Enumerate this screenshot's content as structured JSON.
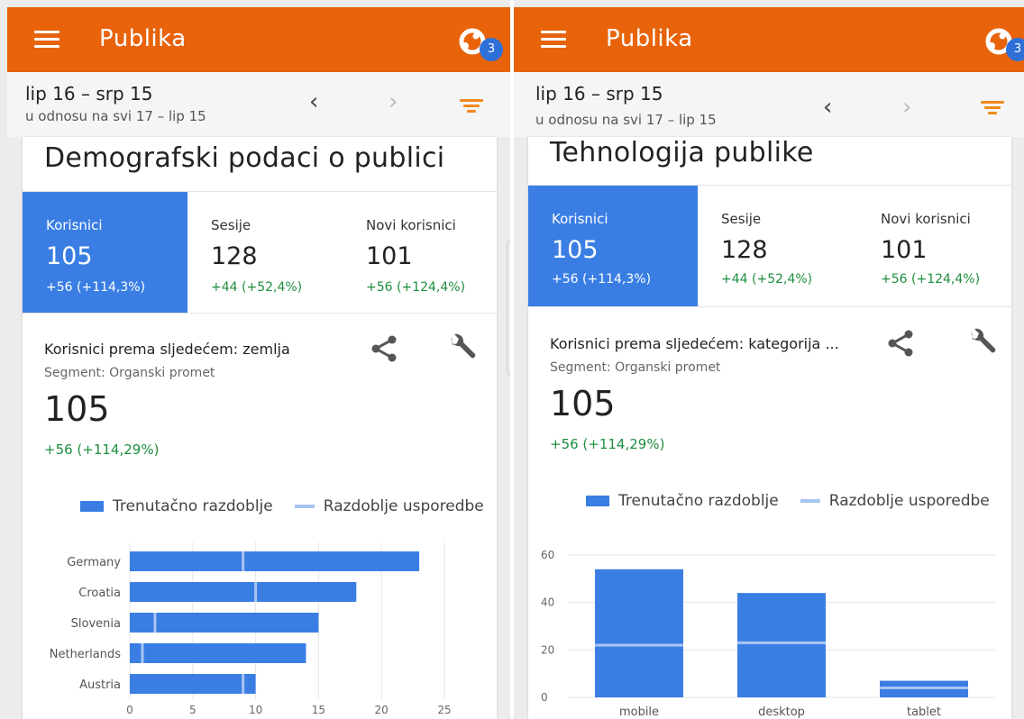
{
  "colors": {
    "appbar": "#e8630a",
    "accent": "#3a7ee4",
    "positive": "#1e8e3e",
    "filter": "#f08a1e",
    "badge": "#2f6fd8",
    "compare": "#a8c4f2"
  },
  "panels": [
    {
      "app_title": "Publika",
      "notification_count": "3",
      "date_range": "lip 16 – srp 15",
      "comparison": "u odnosu na svi 17 – lip 15",
      "prev_label": "‹",
      "next_label": "›",
      "card_title": "Demografski podaci o publici",
      "metrics": [
        {
          "label": "Korisnici",
          "value": "105",
          "change": "+56 (+114,3%)",
          "active": true
        },
        {
          "label": "Sesije",
          "value": "128",
          "change": "+44 (+52,4%)",
          "active": false
        },
        {
          "label": "Novi korisnici",
          "value": "101",
          "change": "+56 (+124,4%)",
          "active": false
        }
      ],
      "report": {
        "title": "Korisnici prema sljedećem: zemlja",
        "segment": "Segment: Organski promet",
        "value": "105",
        "change": "+56 (+114,29%)"
      },
      "legend": {
        "current": "Trenutačno razdoblje",
        "compare": "Razdoblje usporedbe"
      }
    },
    {
      "app_title": "Publika",
      "notification_count": "3",
      "date_range": "lip 16 – srp 15",
      "comparison": "u odnosu na svi 17 – lip 15",
      "prev_label": "‹",
      "next_label": "›",
      "card_title": "Tehnologija publike",
      "metrics": [
        {
          "label": "Korisnici",
          "value": "105",
          "change": "+56 (+114,3%)",
          "active": true
        },
        {
          "label": "Sesije",
          "value": "128",
          "change": "+44 (+52,4%)",
          "active": false
        },
        {
          "label": "Novi korisnici",
          "value": "101",
          "change": "+56 (+124,4%)",
          "active": false
        }
      ],
      "report": {
        "title": "Korisnici prema sljedećem: kategorija ...",
        "segment": "Segment: Organski promet",
        "value": "105",
        "change": "+56 (+114,29%)"
      },
      "legend": {
        "current": "Trenutačno razdoblje",
        "compare": "Razdoblje usporedbe"
      }
    }
  ],
  "chart_data": [
    {
      "type": "bar",
      "orientation": "horizontal",
      "categories": [
        "Germany",
        "Croatia",
        "Slovenia",
        "Netherlands",
        "Austria"
      ],
      "series": [
        {
          "name": "Trenutačno razdoblje",
          "values": [
            23,
            18,
            15,
            14,
            10
          ]
        },
        {
          "name": "Razdoblje usporedbe",
          "values": [
            9,
            10,
            2,
            1,
            9
          ]
        }
      ],
      "x_ticks": [
        0,
        5,
        10,
        15,
        20,
        25
      ],
      "xlim": [
        0,
        25
      ],
      "grid": true,
      "legend": "top"
    },
    {
      "type": "bar",
      "orientation": "vertical",
      "categories": [
        "mobile",
        "desktop",
        "tablet"
      ],
      "series": [
        {
          "name": "Trenutačno razdoblje",
          "values": [
            54,
            44,
            7
          ]
        },
        {
          "name": "Razdoblje usporedbe",
          "values": [
            22,
            23,
            4
          ]
        }
      ],
      "y_ticks": [
        0,
        20,
        40,
        60
      ],
      "ylim": [
        0,
        60
      ],
      "grid": true,
      "legend": "top"
    }
  ]
}
